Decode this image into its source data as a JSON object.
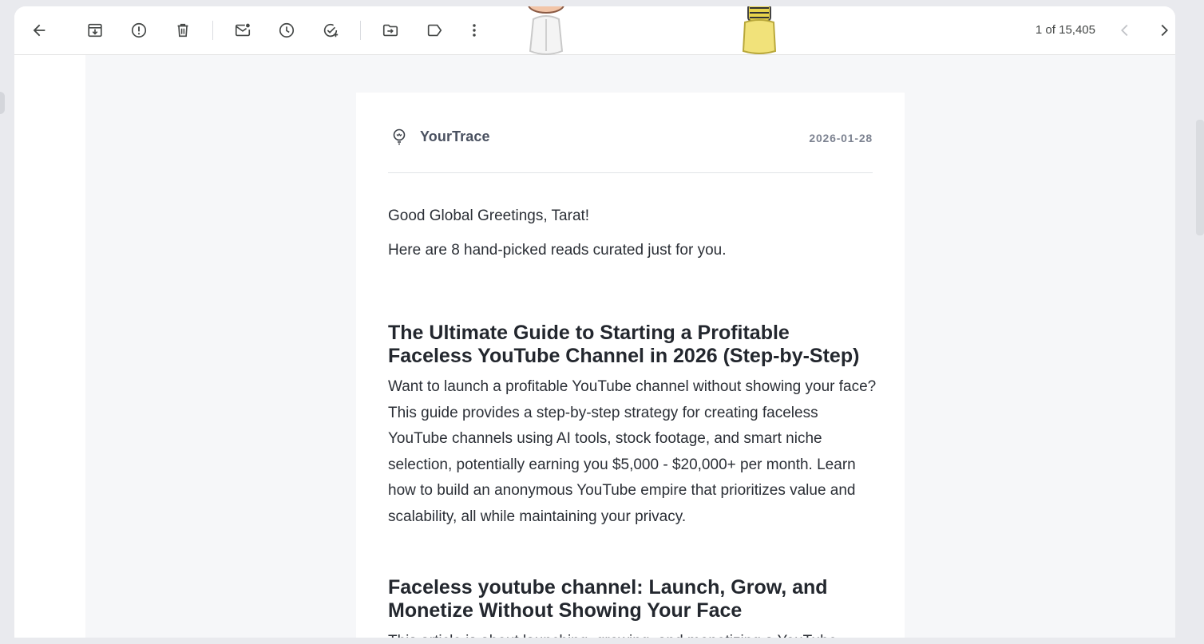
{
  "toolbar": {
    "back_icon": "arrow-left-icon",
    "actions": [
      {
        "name": "archive",
        "icon": "archive-icon"
      },
      {
        "name": "report-spam",
        "icon": "report-icon"
      },
      {
        "name": "delete",
        "icon": "trash-icon"
      },
      {
        "name": "mark-unread",
        "icon": "mail-unread-icon"
      },
      {
        "name": "snooze",
        "icon": "clock-icon"
      },
      {
        "name": "add-to-tasks",
        "icon": "task-add-icon"
      },
      {
        "name": "move-to",
        "icon": "folder-move-icon"
      },
      {
        "name": "labels",
        "icon": "label-icon"
      },
      {
        "name": "more",
        "icon": "more-vert-icon"
      }
    ],
    "count": "1 of 15,405"
  },
  "email": {
    "brand_name": "YourTrace",
    "date": "2026-01-28",
    "greeting": "Good Global Greetings, Tarat!",
    "intro": "Here are 8 hand-picked reads curated just for you.",
    "articles": [
      {
        "title": "The Ultimate Guide to Starting a Profitable Faceless YouTube Channel in 2026 (Step-by-Step)",
        "summary": "Want to launch a profitable YouTube channel without showing your face? This guide provides a step-by-step strategy for creating faceless YouTube channels using AI tools, stock footage, and smart niche selection, potentially earning you $5,000 - $20,000+ per month. Learn how to build an anonymous YouTube empire that prioritizes value and scalability, all while maintaining your privacy."
      },
      {
        "title": "Faceless youtube channel: Launch, Grow, and Monetize Without Showing Your Face",
        "summary": "This article is about launching, growing, and monetizing a YouTube"
      }
    ]
  },
  "colors": {
    "page_bg": "#f6f7f9",
    "card_bg": "#ffffff",
    "text": "#2b2f36",
    "muted": "#7d8391",
    "icon": "#444746"
  }
}
